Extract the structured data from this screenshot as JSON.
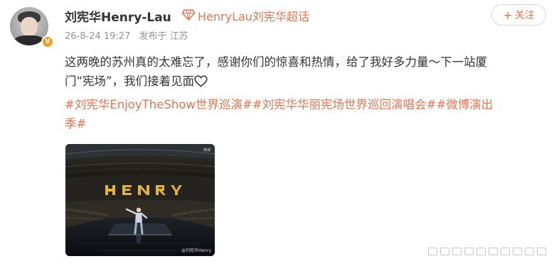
{
  "user": {
    "name": "刘宪华Henry-Lau",
    "verified_badge": "V",
    "avatar_icon": "user-avatar"
  },
  "supertopic": {
    "label": "HenryLau刘宪华超话",
    "icon": "diamond-icon"
  },
  "meta": {
    "time": "26-8-24 19:27",
    "source": "发布于 江苏"
  },
  "follow_button": {
    "plus": "+",
    "label": "关注"
  },
  "post": {
    "line1": "这两晚的苏州真的太难忘了，感谢你们的惊喜和热情，给了我好多力量～下一站厦",
    "line2": "门“宪场”，我们接着见面",
    "heart_icon": "heart-outline-icon"
  },
  "tags": {
    "line1_tag1": "#刘宪华EnjoyTheShow世界巡演#",
    "line1_tag2": "#刘宪华华丽宪场世界巡回演唱会#",
    "line1_tag3_part": "#微博演出",
    "line2_tag3_part": "季#"
  },
  "photo": {
    "banner_text": "HENRY",
    "watermark": "@刘宪华Henry",
    "corner_label": "微博"
  },
  "colors": {
    "accent": "#eb7350",
    "text": "#333333",
    "meta": "#939393",
    "badge": "#f59a23"
  }
}
